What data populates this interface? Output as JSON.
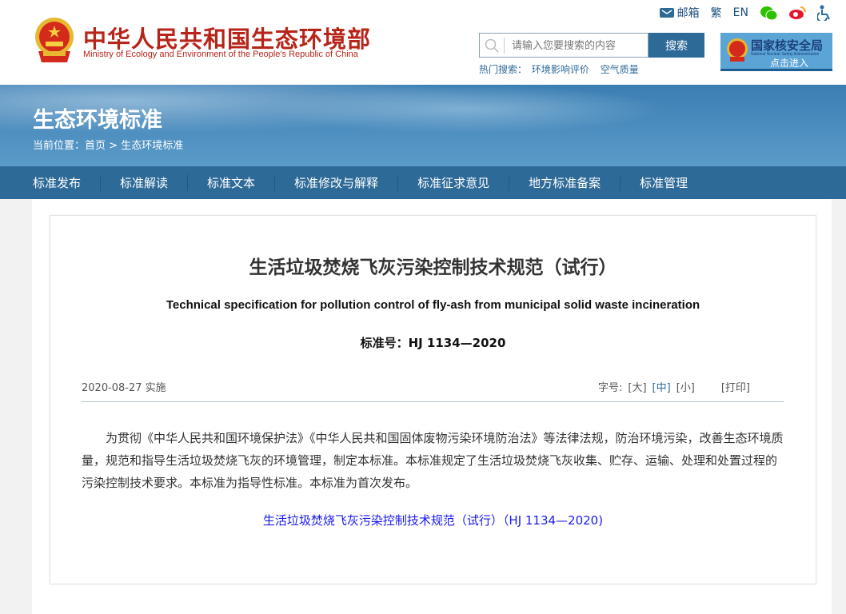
{
  "header": {
    "logo_cn": "中华人民共和国生态环境部",
    "logo_en": "Ministry of Ecology and Environment of the People's Republic of China",
    "top_links": {
      "mail": "邮箱",
      "traditional": "繁",
      "english": "EN"
    },
    "search": {
      "placeholder": "请输入您要搜索的内容",
      "button": "搜索",
      "hot_label": "热门搜索：",
      "hot": [
        "环境影响评价",
        "空气质量"
      ]
    },
    "nsa": {
      "title": "国家核安全局",
      "subtitle": "National Nuclear Safety Administration",
      "enter": "点击进入"
    }
  },
  "banner": {
    "title": "生态环境标准",
    "breadcrumb_label": "当前位置：",
    "breadcrumb": [
      "首页",
      "生态环境标准"
    ],
    "breadcrumb_sep": ">"
  },
  "nav": [
    "标准发布",
    "标准解读",
    "标准文本",
    "标准修改与解释",
    "标准征求意见",
    "地方标准备案",
    "标准管理"
  ],
  "article": {
    "title": "生活垃圾焚烧飞灰污染控制技术规范（试行）",
    "title_en": "Technical specification for pollution control of fly-ash from municipal solid waste incineration",
    "standard_no": "标准号：HJ 1134—2020",
    "date": "2020-08-27 实施",
    "font_size_label": "字号:",
    "font_sizes": [
      "[大]",
      "[中]",
      "[小]"
    ],
    "print": "[打印]",
    "body": "为贯彻《中华人民共和国环境保护法》《中华人民共和国固体废物污染环境防治法》等法律法规，防治环境污染，改善生态环境质量，规范和指导生活垃圾焚烧飞灰的环境管理，制定本标准。本标准规定了生活垃圾焚烧飞灰收集、贮存、运输、处理和处置过程的污染控制技术要求。本标准为指导性标准。本标准为首次发布。",
    "link": "生活垃圾焚烧飞灰污染控制技术规范（试行）（HJ 1134—2020)"
  },
  "colors": {
    "brand_red": "#b7251a",
    "nav_blue": "#2e6a98",
    "link": "#1a1aee"
  }
}
